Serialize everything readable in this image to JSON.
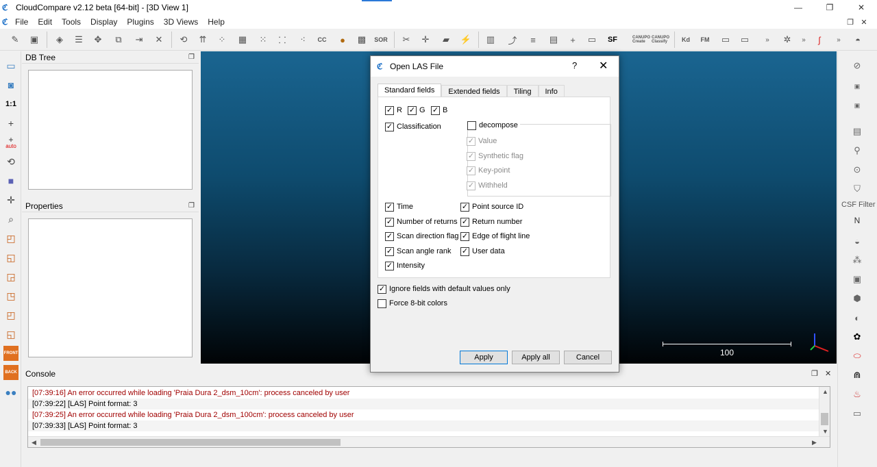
{
  "window": {
    "title": "CloudCompare v2.12 beta [64-bit] - [3D View 1]",
    "minimize": "—",
    "restore": "❐",
    "close": "✕"
  },
  "menu": {
    "items": [
      "File",
      "Edit",
      "Tools",
      "Display",
      "Plugins",
      "3D Views",
      "Help"
    ],
    "restore": "❐",
    "close": "✕"
  },
  "toolbar": {
    "labels": [
      "CC",
      "SOR",
      "SF",
      "Kd",
      "FM",
      "CANUPO Create",
      "CANUPO Classify"
    ]
  },
  "left_tools": {
    "scale_label": "1:1",
    "auto_label": "auto",
    "front_label": "FRONT",
    "back_label": "BACK"
  },
  "db_tree": {
    "title": "DB Tree"
  },
  "properties": {
    "title": "Properties"
  },
  "view3d": {
    "scale_label": "100"
  },
  "console": {
    "title": "Console",
    "lines": [
      {
        "text": "[07:39:16] An error occurred while loading 'Praia Dura 2_dsm_10cm': process canceled by user",
        "type": "error"
      },
      {
        "text": "[07:39:22] [LAS] Point format: 3",
        "type": "info"
      },
      {
        "text": "[07:39:25] An error occurred while loading 'Praia Dura 2_dsm_100cm': process canceled by user",
        "type": "error"
      },
      {
        "text": "[07:39:33] [LAS] Point format: 3",
        "type": "info"
      }
    ]
  },
  "right_tools": {
    "csf_label": "CSF Filter",
    "n_label": "N"
  },
  "dialog": {
    "title": "Open LAS File",
    "help": "?",
    "close": "✕",
    "tabs": [
      "Standard fields",
      "Extended fields",
      "Tiling",
      "Info"
    ],
    "fields": {
      "r": "R",
      "g": "G",
      "b": "B",
      "classification": "Classification",
      "decompose": "decompose",
      "value": "Value",
      "synthetic_flag": "Synthetic flag",
      "key_point": "Key-point",
      "withheld": "Withheld",
      "time": "Time",
      "point_source_id": "Point source ID",
      "number_of_returns": "Number of returns",
      "return_number": "Return number",
      "scan_direction_flag": "Scan direction flag",
      "edge_of_flight_line": "Edge of flight line",
      "scan_angle_rank": "Scan angle rank",
      "user_data": "User data",
      "intensity": "Intensity"
    },
    "ignore_default": "Ignore fields with default values only",
    "force_8bit": "Force 8-bit colors",
    "buttons": {
      "apply": "Apply",
      "apply_all": "Apply all",
      "cancel": "Cancel"
    },
    "checked_mark": "✓"
  }
}
